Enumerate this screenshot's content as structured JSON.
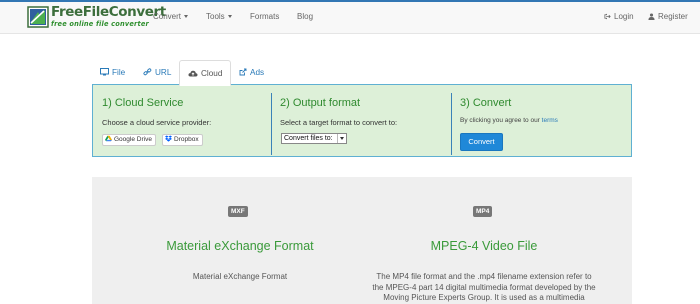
{
  "header": {
    "logo_title": "FreeFileConvert",
    "logo_tagline": "free online file converter",
    "nav": [
      {
        "label": "Convert",
        "dropdown": true
      },
      {
        "label": "Tools",
        "dropdown": true
      },
      {
        "label": "Formats",
        "dropdown": false
      },
      {
        "label": "Blog",
        "dropdown": false
      }
    ],
    "login_label": "Login",
    "register_label": "Register"
  },
  "tabs": [
    {
      "label": "File",
      "icon": "monitor-icon",
      "active": false
    },
    {
      "label": "URL",
      "icon": "link-icon",
      "active": false
    },
    {
      "label": "Cloud",
      "icon": "cloud-icon",
      "active": true
    },
    {
      "label": "Ads",
      "icon": "external-link-icon",
      "active": false
    }
  ],
  "panel": {
    "step1": {
      "title": "1) Cloud Service",
      "text": "Choose a cloud service provider:",
      "google_drive": "Google Drive",
      "dropbox": "Dropbox"
    },
    "step2": {
      "title": "2) Output format",
      "text": "Select a target format to convert to:",
      "select_value": "Convert files to:"
    },
    "step3": {
      "title": "3) Convert",
      "terms_prefix": "By clicking you agree to our",
      "terms_link": "terms",
      "button": "Convert"
    }
  },
  "formats": {
    "left": {
      "badge": "MXF",
      "title": "Material eXchange Format",
      "description": "Material eXchange Format"
    },
    "right": {
      "badge": "MP4",
      "title": "MPEG-4 Video File",
      "description_lines": [
        "The MP4 file format and the .mp4 filename extension refer to",
        "the MPEG-4 part 14 digital multimedia format developed by the",
        "Moving Picture Experts Group. It is used as a multimedia"
      ]
    }
  },
  "colors": {
    "brand_green": "#3a9a3a",
    "link_blue": "#2a7ab8",
    "button_blue": "#1f88d8",
    "panel_bg": "#ddf0d8",
    "panel_border": "#5fb0d2"
  }
}
